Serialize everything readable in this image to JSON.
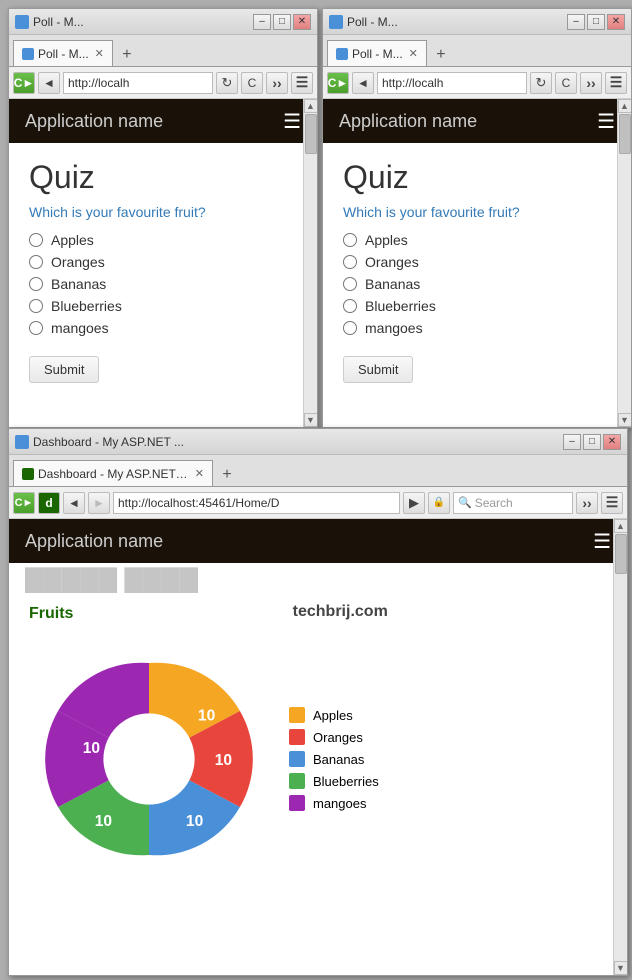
{
  "desktop": {
    "background": "#adadad"
  },
  "window1": {
    "title": "Poll - M...",
    "url": "http://localh",
    "tabs": [
      {
        "label": "Poll - M...",
        "active": true
      },
      {
        "label": "+",
        "is_new": true
      }
    ],
    "controls": [
      "_",
      "□",
      "×"
    ],
    "app_name": "Application name",
    "quiz": {
      "title": "Quiz",
      "question": "Which is your favourite fruit?",
      "options": [
        "Apples",
        "Oranges",
        "Bananas",
        "Blueberries",
        "mangoes"
      ],
      "submit_label": "Submit"
    }
  },
  "window2": {
    "title": "Poll - M...",
    "url": "http://localh",
    "tabs": [
      {
        "label": "Poll - M...",
        "active": true
      },
      {
        "label": "+",
        "is_new": true
      }
    ],
    "controls": [
      "_",
      "□",
      "×"
    ],
    "app_name": "Application name",
    "quiz": {
      "title": "Quiz",
      "question": "Which is your favourite fruit?",
      "options": [
        "Apples",
        "Oranges",
        "Bananas",
        "Blueberries",
        "mangoes"
      ],
      "submit_label": "Submit"
    }
  },
  "window3": {
    "title": "Dashboard - My ASP.NET ...",
    "url": "http://localhost:45461/Home/D",
    "search_placeholder": "Search",
    "tabs": [
      {
        "label": "Dashboard - My ASP.NET ...",
        "active": true
      },
      {
        "label": "+",
        "is_new": true
      }
    ],
    "controls": [
      "_",
      "□",
      "×"
    ],
    "app_name": "Application name",
    "partial_title": "Chart title",
    "chart": {
      "title": "Fruits",
      "watermark": "techbrij.com",
      "segments": [
        {
          "label": "Apples",
          "value": 10,
          "color": "#f5a623",
          "start_angle": -90,
          "sweep": 72
        },
        {
          "label": "Oranges",
          "value": 10,
          "color": "#e8463c",
          "start_angle": -18,
          "sweep": 72
        },
        {
          "label": "Bananas",
          "value": 10,
          "color": "#4a90d9",
          "start_angle": 54,
          "sweep": 72
        },
        {
          "label": "Blueberries",
          "value": 10,
          "color": "#4caf50",
          "start_angle": 126,
          "sweep": 72
        },
        {
          "label": "mangoes",
          "value": 10,
          "color": "#9c27b0",
          "start_angle": 198,
          "sweep": 72
        }
      ]
    }
  }
}
